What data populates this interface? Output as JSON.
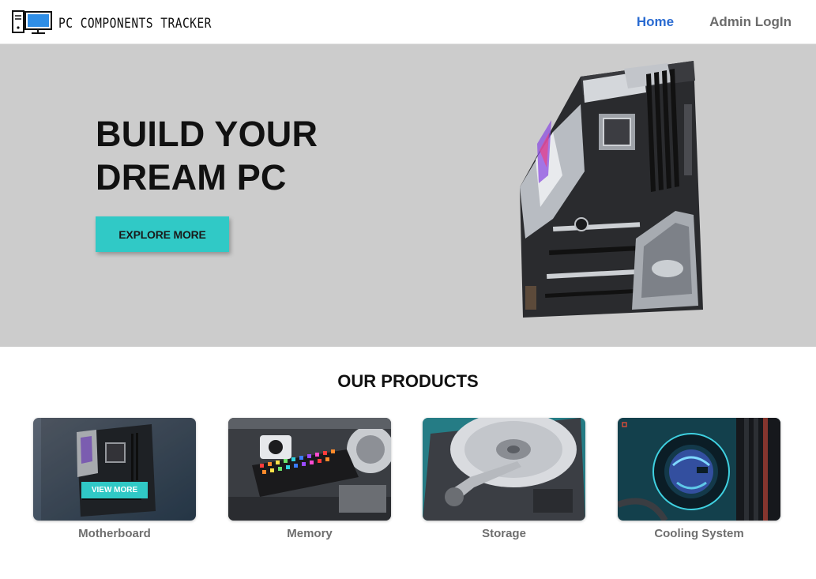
{
  "nav": {
    "brand": "PC COMPONENTS TRACKER",
    "links": [
      {
        "label": "Home",
        "active": true
      },
      {
        "label": "Admin LogIn",
        "active": false
      }
    ]
  },
  "hero": {
    "title_line1": "BUILD YOUR",
    "title_line2": "DREAM PC",
    "cta_label": "EXPLORE MORE"
  },
  "products": {
    "title": "OUR PRODUCTS",
    "hover_button": "VIEW MORE",
    "items": [
      {
        "label": "Motherboard"
      },
      {
        "label": "Memory"
      },
      {
        "label": "Storage"
      },
      {
        "label": "Cooling System"
      }
    ]
  },
  "colors": {
    "accent": "#30c9c6",
    "nav_active": "#2a6bd1",
    "nav_inactive": "#6b6b6b",
    "hero_bg": "#cccccc"
  }
}
